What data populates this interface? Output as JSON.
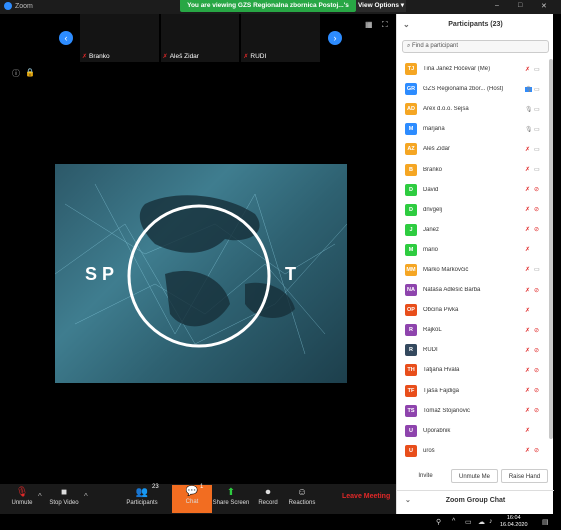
{
  "window": {
    "app_name": "Zoom",
    "banner": "You are viewing GZS Regionalna zbornica Postoj...'s screen",
    "view_options": "View Options ▾",
    "controls": [
      "–",
      "□",
      "✕"
    ]
  },
  "strip": {
    "prev_label": "‹",
    "next_label": "›",
    "tiles": [
      {
        "name": "Branko"
      },
      {
        "name": "Aleš Zidar"
      },
      {
        "name": "RUDI"
      }
    ]
  },
  "shared_screen": {
    "text_left": "S P",
    "text_right": "T"
  },
  "toolbar": {
    "unmute": "Unmute",
    "stop_video": "Stop Video",
    "participants": "Participants",
    "participants_count": "23",
    "chat": "Chat",
    "chat_badge": "1",
    "share_screen": "Share Screen",
    "record": "Record",
    "reactions": "Reactions",
    "leave": "Leave Meeting"
  },
  "panel": {
    "title": "Participants (23)",
    "search_placeholder": "Find a participant",
    "participants": [
      {
        "initials": "TJ",
        "name": "Tina Janež Hočevar (Me)",
        "color": "#f5a623",
        "mic": "off",
        "cam": "on"
      },
      {
        "initials": "GR",
        "name": "GZS Regionalna zbor... (Host)",
        "color": "#2d8cff",
        "mic": "on",
        "cam": "on",
        "host": true
      },
      {
        "initials": "AD",
        "name": "Arex d.o.o. Sejsa",
        "color": "#f5a623",
        "mic": "on",
        "cam": "on"
      },
      {
        "initials": "M",
        "name": "marjana",
        "color": "#2d8cff",
        "mic": "on",
        "cam": "on"
      },
      {
        "initials": "AZ",
        "name": "Aleš Zidar",
        "color": "#f5a623",
        "mic": "off",
        "cam": "on"
      },
      {
        "initials": "B",
        "name": "Branko",
        "color": "#f5a623",
        "mic": "off",
        "cam": "on"
      },
      {
        "initials": "D",
        "name": "David",
        "color": "#2ecc40",
        "mic": "off",
        "cam": "off"
      },
      {
        "initials": "D",
        "name": "dnvgelj",
        "color": "#2ecc40",
        "mic": "off",
        "cam": "off"
      },
      {
        "initials": "J",
        "name": "Janez",
        "color": "#2ecc40",
        "mic": "off",
        "cam": "off"
      },
      {
        "initials": "M",
        "name": "mario",
        "color": "#2ecc40",
        "mic": "off",
        "cam": "none"
      },
      {
        "initials": "MM",
        "name": "Marko Markovčič",
        "color": "#f5a623",
        "mic": "off",
        "cam": "on"
      },
      {
        "initials": "NA",
        "name": "Nataša Adlešič Barba",
        "color": "#8e44ad",
        "mic": "off",
        "cam": "off"
      },
      {
        "initials": "OP",
        "name": "Obcina Pivka",
        "color": "#e84e1b",
        "mic": "off",
        "cam": "none"
      },
      {
        "initials": "R",
        "name": "RajkoL",
        "color": "#8e44ad",
        "mic": "off",
        "cam": "off"
      },
      {
        "initials": "R",
        "name": "RUDI",
        "color": "#34495e",
        "mic": "off",
        "cam": "off"
      },
      {
        "initials": "TH",
        "name": "Tatjana Hvala",
        "color": "#e84e1b",
        "mic": "off",
        "cam": "off"
      },
      {
        "initials": "TF",
        "name": "Tjaša Fajdiga",
        "color": "#e84e1b",
        "mic": "off",
        "cam": "off"
      },
      {
        "initials": "TS",
        "name": "Tomaž Stojanovic",
        "color": "#8e44ad",
        "mic": "off",
        "cam": "off"
      },
      {
        "initials": "U",
        "name": "Uporabnik",
        "color": "#8e44ad",
        "mic": "off",
        "cam": "none"
      },
      {
        "initials": "U",
        "name": "uroš",
        "color": "#e84e1b",
        "mic": "off",
        "cam": "off"
      }
    ],
    "invite": "Invite",
    "unmute_me": "Unmute Me",
    "raise_hand": "Raise Hand",
    "group_chat": "Zoom Group Chat"
  },
  "taskbar": {
    "time": "16:04",
    "date": "16.04.2020"
  },
  "colors": {
    "accent": "#2d8cff",
    "chat": "#f26d21",
    "banner": "#28a745",
    "leave": "#e02828"
  }
}
